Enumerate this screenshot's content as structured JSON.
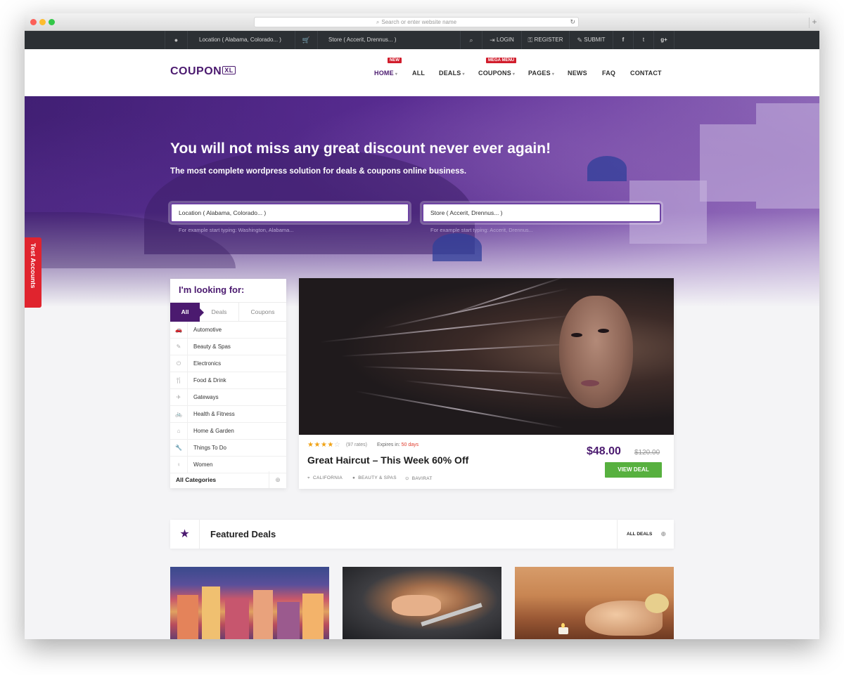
{
  "browser": {
    "url_placeholder": "Search or enter website name"
  },
  "topbar": {
    "location_label": "Location ( Alabama, Colorado... )",
    "store_label": "Store ( Accerit, Drennus... )",
    "login": "LOGIN",
    "register": "REGISTER",
    "submit": "SUBMIT"
  },
  "nav": {
    "logo": "COUPON",
    "logo_badge": "XL",
    "items": [
      "HOME",
      "ALL",
      "DEALS",
      "COUPONS",
      "PAGES",
      "NEWS",
      "FAQ",
      "CONTACT"
    ],
    "badge_new": "NEW",
    "badge_mega": "MEGA MENU"
  },
  "hero": {
    "title": "You will not miss any great discount never ever again!",
    "subtitle": "The most complete wordpress solution for deals & coupons online business.",
    "location_input": "Location ( Alabama, Colorado... )",
    "location_hint": "For example start typing: Washington, Alabama...",
    "store_input": "Store ( Accerit, Drennus... )",
    "store_hint": "For example start typing: Accerit, Drennus..."
  },
  "side_tab": {
    "label": "Test Accounts"
  },
  "looking": {
    "title": "I'm looking for:",
    "tabs": [
      "All",
      "Deals",
      "Coupons"
    ],
    "categories": [
      {
        "label": "Automotive",
        "icon": "car-icon"
      },
      {
        "label": "Beauty & Spas",
        "icon": "brush-icon"
      },
      {
        "label": "Electronics",
        "icon": "plug-icon"
      },
      {
        "label": "Food & Drink",
        "icon": "cutlery-icon"
      },
      {
        "label": "Gateways",
        "icon": "plane-icon"
      },
      {
        "label": "Health & Fitness",
        "icon": "bicycle-icon"
      },
      {
        "label": "Home & Garden",
        "icon": "home-icon"
      },
      {
        "label": "Things To Do",
        "icon": "wrench-icon"
      },
      {
        "label": "Women",
        "icon": "female-icon"
      }
    ],
    "all_categories": "All Categories"
  },
  "deal": {
    "rating": 4,
    "rating_max": 5,
    "rates": "(97 rates)",
    "expires_label": "Expires in:",
    "expires_value": "50 days",
    "title": "Great Haircut – This Week 60% Off",
    "location": "CALIFORNIA",
    "category": "BEAUTY & SPAS",
    "store": "BAVIRAT",
    "price": "$48.00",
    "old_price": "$120.00",
    "button": "VIEW DEAL"
  },
  "featured": {
    "title": "Featured Deals",
    "all_label": "ALL DEALS"
  },
  "colors": {
    "brand_purple": "#4b1a6f",
    "accent_green": "#57b03f",
    "badge_red": "#d11d2c",
    "topbar_dark": "#2c3034"
  }
}
